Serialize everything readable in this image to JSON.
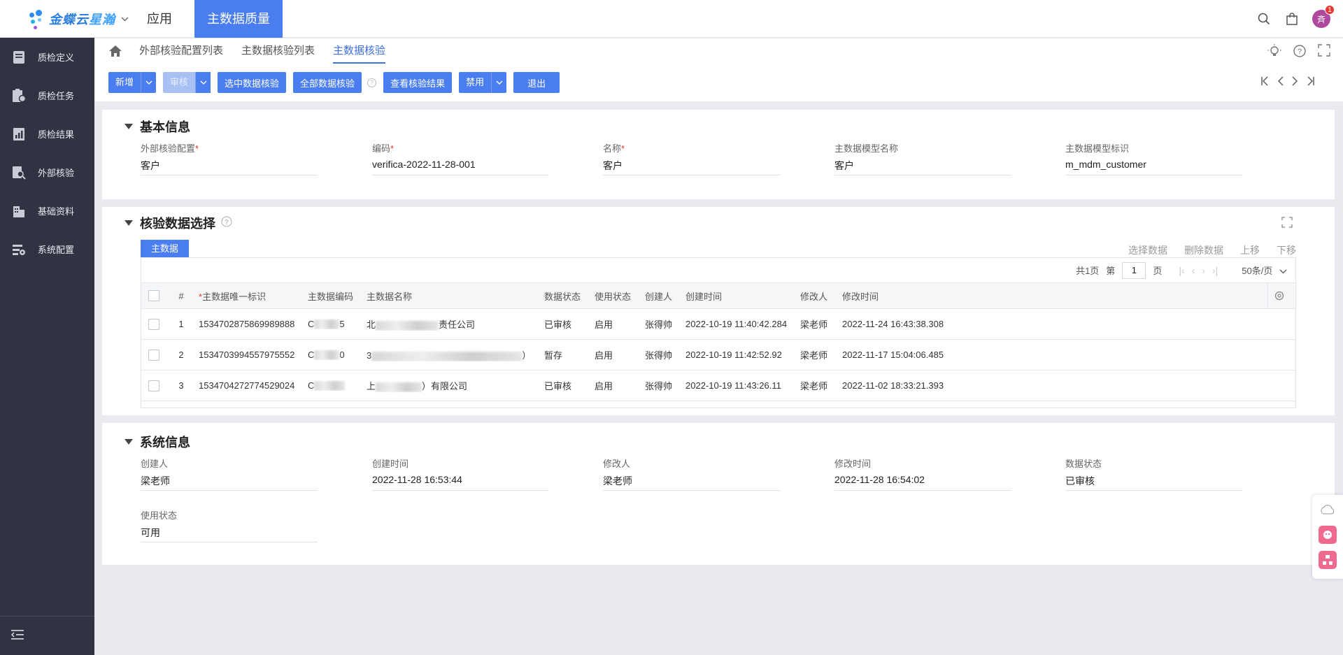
{
  "header": {
    "logo_text": "金蝶云",
    "logo_sub": "星瀚",
    "app_label": "应用",
    "active_module": "主数据质量",
    "avatar_text": "斉",
    "notification_count": "1"
  },
  "sidebar": {
    "items": [
      {
        "label": "质检定义",
        "icon": "book-icon"
      },
      {
        "label": "质检任务",
        "icon": "task-icon"
      },
      {
        "label": "质检结果",
        "icon": "report-icon"
      },
      {
        "label": "外部核验",
        "icon": "search-doc-icon"
      },
      {
        "label": "基础资料",
        "icon": "building-icon"
      },
      {
        "label": "系统配置",
        "icon": "settings-icon"
      }
    ]
  },
  "tabs": [
    "外部核验配置列表",
    "主数据核验列表",
    "主数据核验"
  ],
  "toolbar": {
    "new_label": "新增",
    "audit_label": "审核",
    "check_selected_label": "选中数据核验",
    "check_all_label": "全部数据核验",
    "view_result_label": "查看核验结果",
    "disable_label": "禁用",
    "exit_label": "退出"
  },
  "basic": {
    "title": "基本信息",
    "fields": [
      {
        "label": "外部核验配置",
        "required": true,
        "value": "客户"
      },
      {
        "label": "编码",
        "required": true,
        "value": "verifica-2022-11-28-001"
      },
      {
        "label": "名称",
        "required": true,
        "value": "客户"
      },
      {
        "label": "主数据模型名称",
        "required": false,
        "value": "客户"
      },
      {
        "label": "主数据模型标识",
        "required": false,
        "value": "m_mdm_customer"
      }
    ]
  },
  "verify": {
    "title": "核验数据选择",
    "subtab": "主数据",
    "actions": [
      "选择数据",
      "删除数据",
      "上移",
      "下移"
    ],
    "pager": {
      "total": "共1页",
      "page_prefix": "第",
      "page": "1",
      "page_suffix": "页",
      "page_size": "50条/页"
    },
    "columns": [
      "#",
      "主数据唯一标识",
      "主数据编码",
      "主数据名称",
      "数据状态",
      "使用状态",
      "创建人",
      "创建时间",
      "修改人",
      "修改时间"
    ],
    "rows": [
      {
        "no": "1",
        "id": "1534702875869989888",
        "code_tail": "5",
        "name_head": "北",
        "name_tail": "责任公司",
        "status": "已审核",
        "use": "启用",
        "creator": "张得帅",
        "created": "2022-10-19 11:40:42.284",
        "modifier": "梁老师",
        "modified": "2022-11-24 16:43:38.308"
      },
      {
        "no": "2",
        "id": "1534703994557975552",
        "code_tail": "0",
        "name_head": "3",
        "name_tail": "）",
        "status": "暂存",
        "use": "启用",
        "creator": "张得帅",
        "created": "2022-10-19 11:42:52.92",
        "modifier": "梁老师",
        "modified": "2022-11-17 15:04:06.485"
      },
      {
        "no": "3",
        "id": "1534704272774529024",
        "code_tail": "",
        "name_head": "上",
        "name_tail": "）有限公司",
        "status": "已审核",
        "use": "启用",
        "creator": "张得帅",
        "created": "2022-10-19 11:43:26.11",
        "modifier": "梁老师",
        "modified": "2022-11-02 18:33:21.393"
      }
    ]
  },
  "system": {
    "title": "系统信息",
    "fields": [
      {
        "label": "创建人",
        "value": "梁老师"
      },
      {
        "label": "创建时间",
        "value": "2022-11-28 16:53:44"
      },
      {
        "label": "修改人",
        "value": "梁老师"
      },
      {
        "label": "修改时间",
        "value": "2022-11-28 16:54:02"
      },
      {
        "label": "数据状态",
        "value": "已审核"
      },
      {
        "label": "使用状态",
        "value": "可用"
      }
    ]
  },
  "colors": {
    "primary": "#4a7ef0",
    "sidebar_bg": "#2f3342",
    "required": "#e8382f"
  }
}
